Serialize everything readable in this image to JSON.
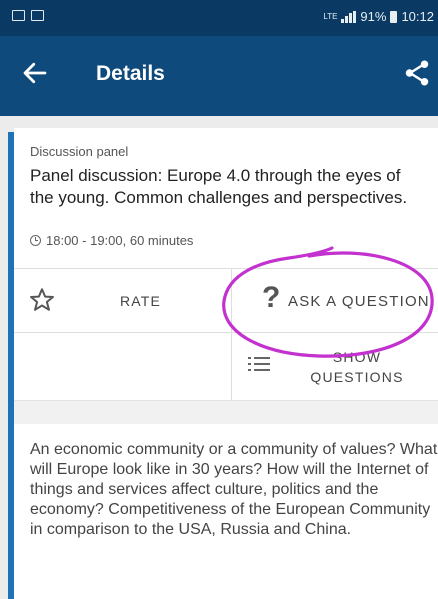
{
  "status_bar": {
    "network": "LTE",
    "battery": "91%",
    "time": "10:12"
  },
  "header": {
    "title": "Details",
    "icons": {
      "back": "arrow-left",
      "share": "share"
    }
  },
  "session": {
    "category": "Discussion panel",
    "title": "Panel discussion: Europe 4.0 through the eyes of the young. Common challenges and perspectives.",
    "time": "18:00 - 19:00, 60 minutes"
  },
  "actions": {
    "rate": "RATE",
    "ask": "ASK A QUESTION",
    "show_line1": "SHOW",
    "show_line2": "QUESTIONS"
  },
  "description": "An economic community or a community of values? What will Europe look like in 30 years? How will the Internet of things and services affect culture, politics and the economy? Competitiveness of the European Community in comparison to the USA, Russia and China.",
  "colors": {
    "status_bar": "#0a3a63",
    "app_bar": "#0e4a7c",
    "accent": "#1e73b8",
    "annotation": "#c331cf"
  }
}
